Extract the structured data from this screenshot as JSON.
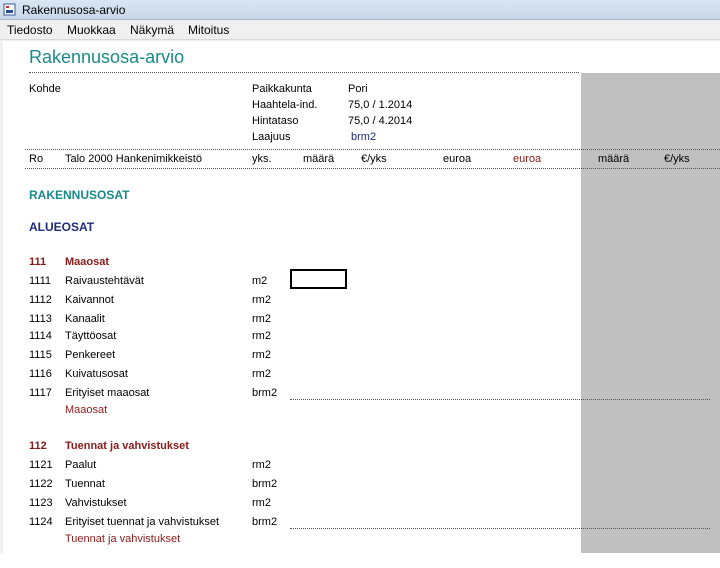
{
  "window": {
    "title": "Rakennusosa-arvio"
  },
  "menu": [
    "Tiedosto",
    "Muokkaa",
    "Näkymä",
    "Mitoitus"
  ],
  "app_title": "Rakennusosa-arvio",
  "info": {
    "kohde_label": "Kohde",
    "paikkakunta_label": "Paikkakunta",
    "paikkakunta_value": "Pori",
    "haahtela_label": "Haahtela-ind.",
    "haahtela_value": "75,0 / 1.2014",
    "hintataso_label": "Hintataso",
    "hintataso_value": "75,0 / 4.2014",
    "laajuus_label": "Laajuus",
    "laajuus_value": "brm2"
  },
  "columns": {
    "ro": "Ro",
    "name": "Talo 2000 Hankenimikkeistö",
    "yks": "yks.",
    "maara": "määrä",
    "eur_yks": "€/yks",
    "euroa": "euroa",
    "euroa2": "euroa",
    "maara2": "määrä",
    "eur_yks2": "€/yks"
  },
  "section_title": "RAKENNUSOSAT",
  "subsection_title": "ALUEOSAT",
  "groups": [
    {
      "code": "111",
      "name": "Maaosat",
      "subtotal": "Maaosat",
      "rows": [
        {
          "code": "1111",
          "name": "Raivaustehtävät",
          "unit": "m2"
        },
        {
          "code": "1112",
          "name": "Kaivannot",
          "unit": "rm2"
        },
        {
          "code": "1113",
          "name": "Kanaalit",
          "unit": "rm2"
        },
        {
          "code": "1114",
          "name": "Täyttöosat",
          "unit": "rm2"
        },
        {
          "code": "1115",
          "name": "Penkereet",
          "unit": "rm2"
        },
        {
          "code": "1116",
          "name": "Kuivatusosat",
          "unit": "rm2"
        },
        {
          "code": "1117",
          "name": "Erityiset maaosat",
          "unit": "brm2"
        }
      ]
    },
    {
      "code": "112",
      "name": "Tuennat ja vahvistukset",
      "subtotal": "Tuennat ja vahvistukset",
      "rows": [
        {
          "code": "1121",
          "name": "Paalut",
          "unit": "rm2"
        },
        {
          "code": "1122",
          "name": "Tuennat",
          "unit": "brm2"
        },
        {
          "code": "1123",
          "name": "Vahvistukset",
          "unit": "rm2"
        },
        {
          "code": "1124",
          "name": "Erityiset tuennat ja vahvistukset",
          "unit": "brm2"
        }
      ]
    }
  ]
}
